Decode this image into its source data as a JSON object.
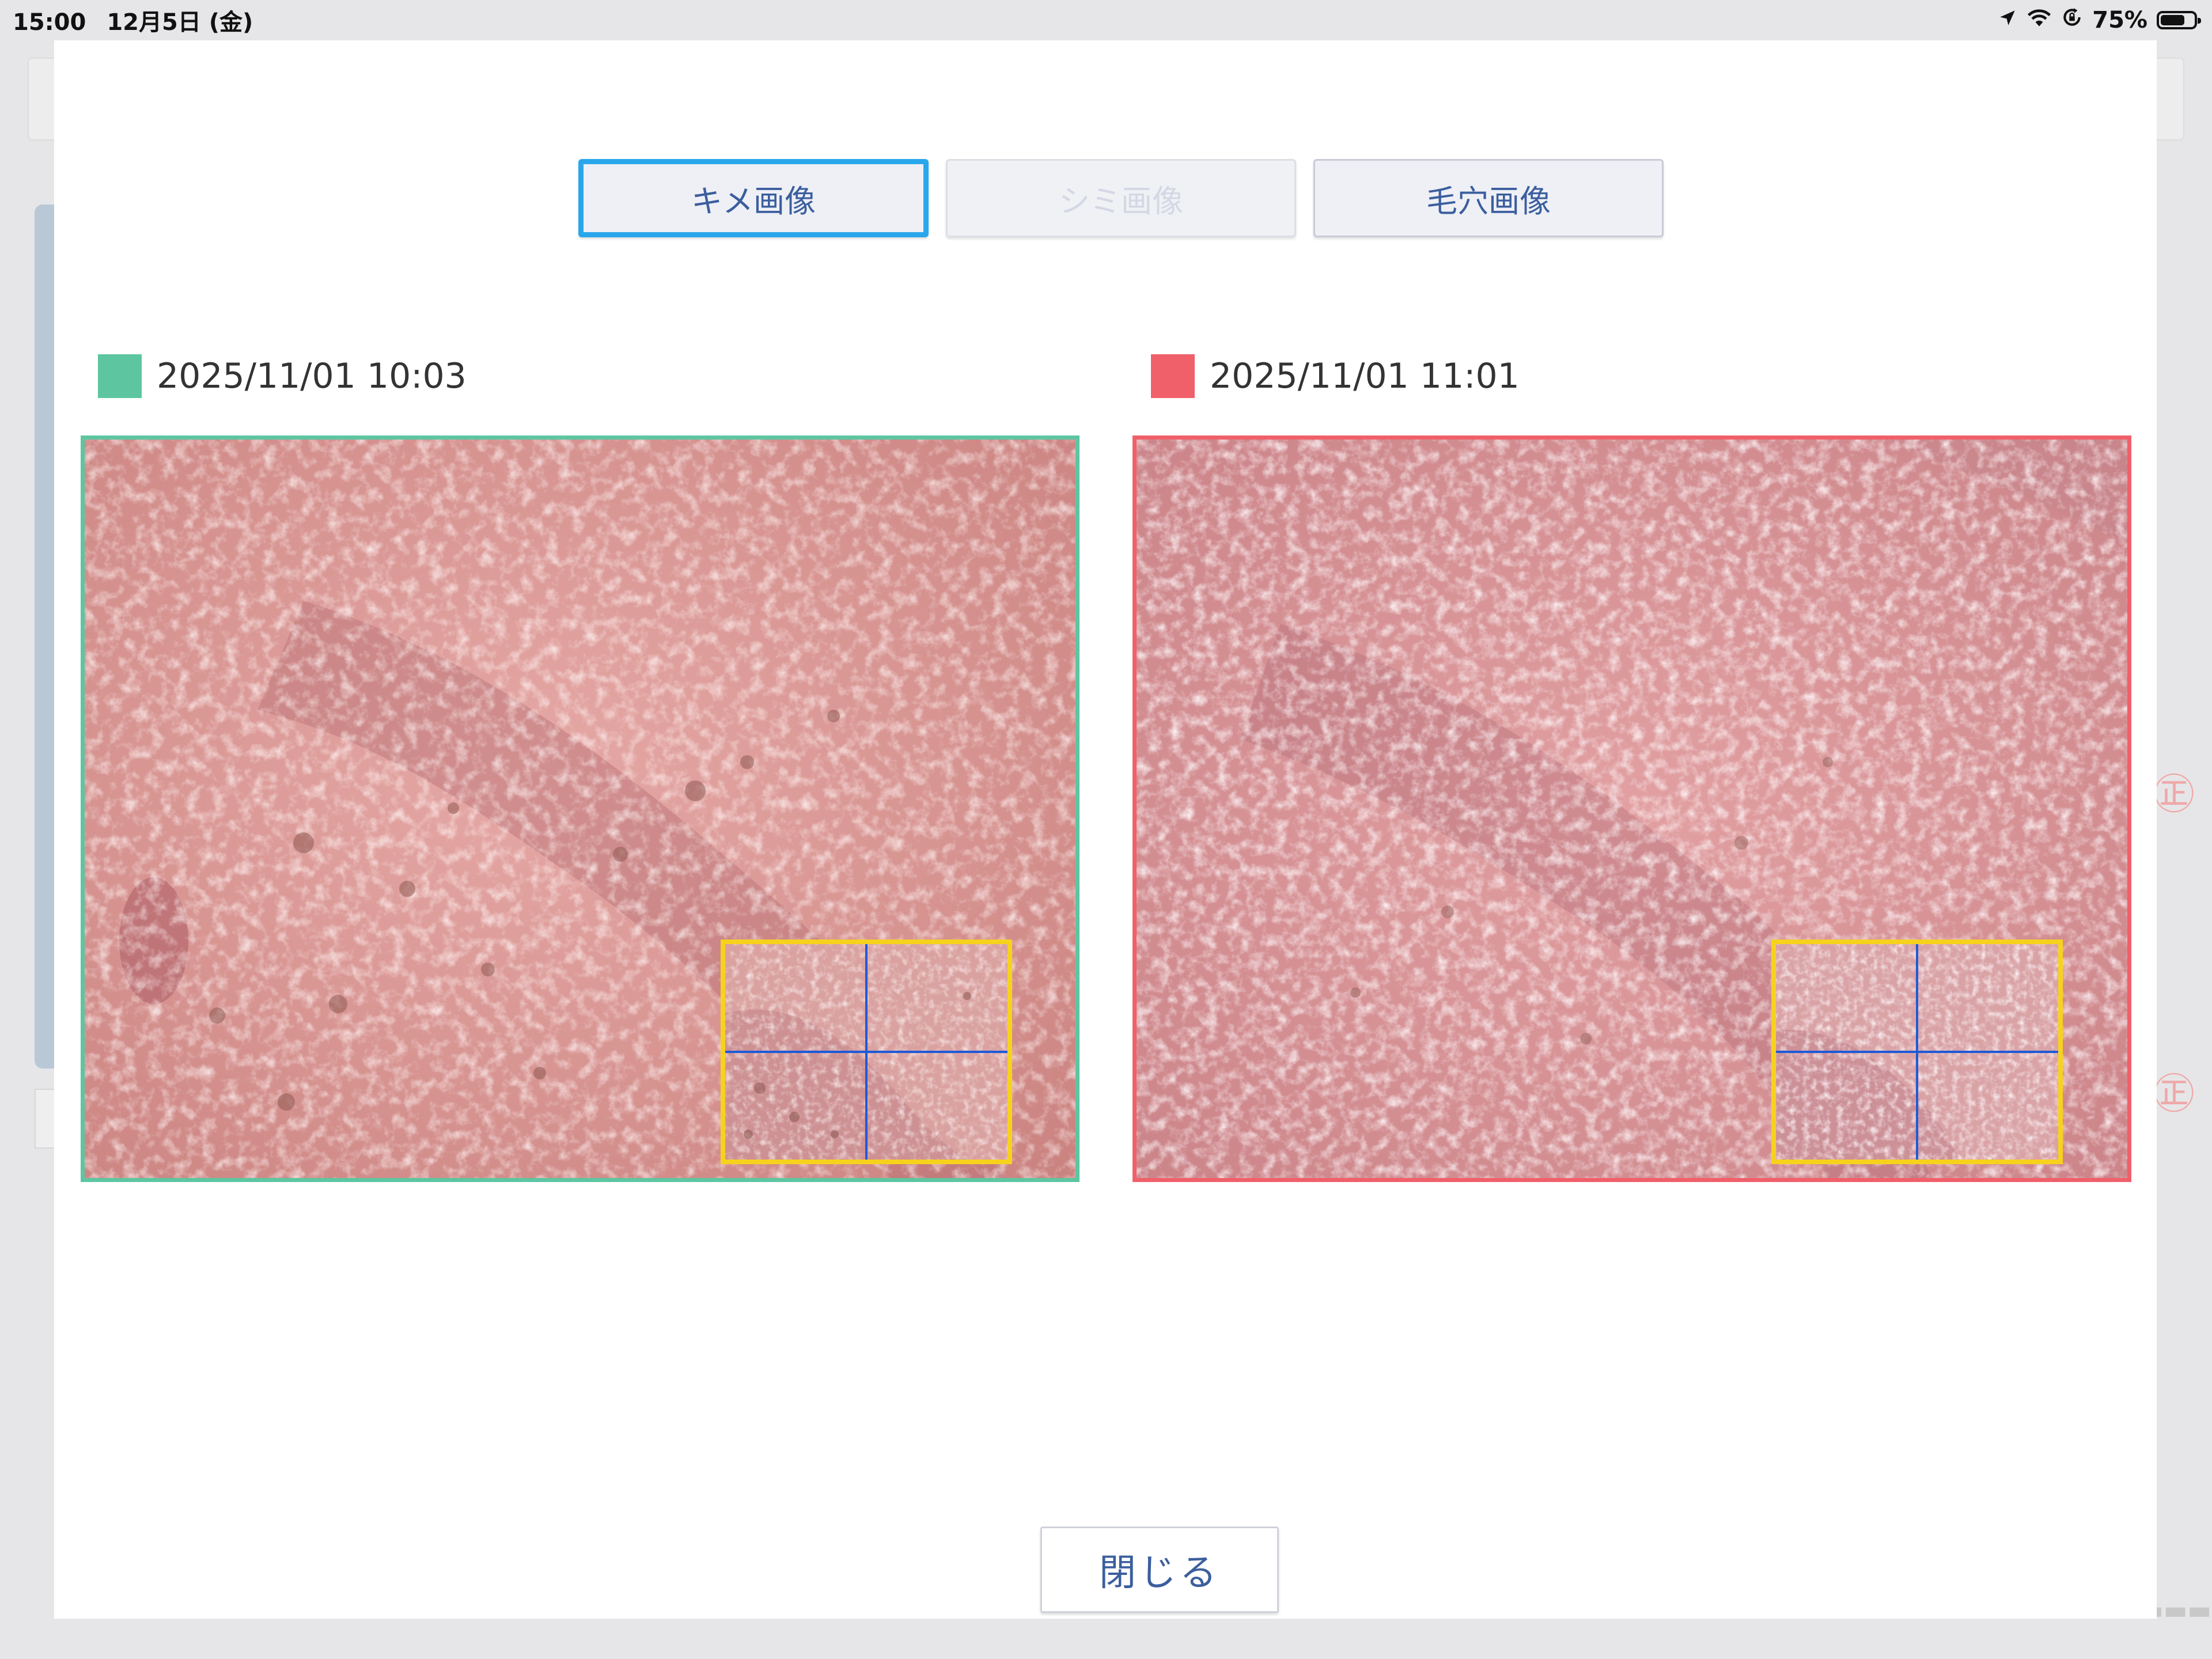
{
  "status_bar": {
    "time": "15:00",
    "date": "12月5日 (金)",
    "battery": "75%",
    "battery_level": 0.75
  },
  "tabs": [
    {
      "label": "キメ画像",
      "state": "active"
    },
    {
      "label": "シミ画像",
      "state": "disabled"
    },
    {
      "label": "毛穴画像",
      "state": "normal"
    }
  ],
  "left_panel": {
    "timestamp": "2025/11/01 10:03",
    "color": "#5dc6a1"
  },
  "right_panel": {
    "timestamp": "2025/11/01 11:01",
    "color": "#f0606a"
  },
  "close_button": {
    "label": "閉じる"
  },
  "colors": {
    "tab_active_border": "#2aa7ea",
    "zoom_box_border": "#f7d21c",
    "crosshair": "#1e5ad8",
    "button_text": "#3b5e9e"
  },
  "icons": [
    "location-arrow-icon",
    "wifi-icon",
    "orientation-lock-icon",
    "battery-icon"
  ]
}
